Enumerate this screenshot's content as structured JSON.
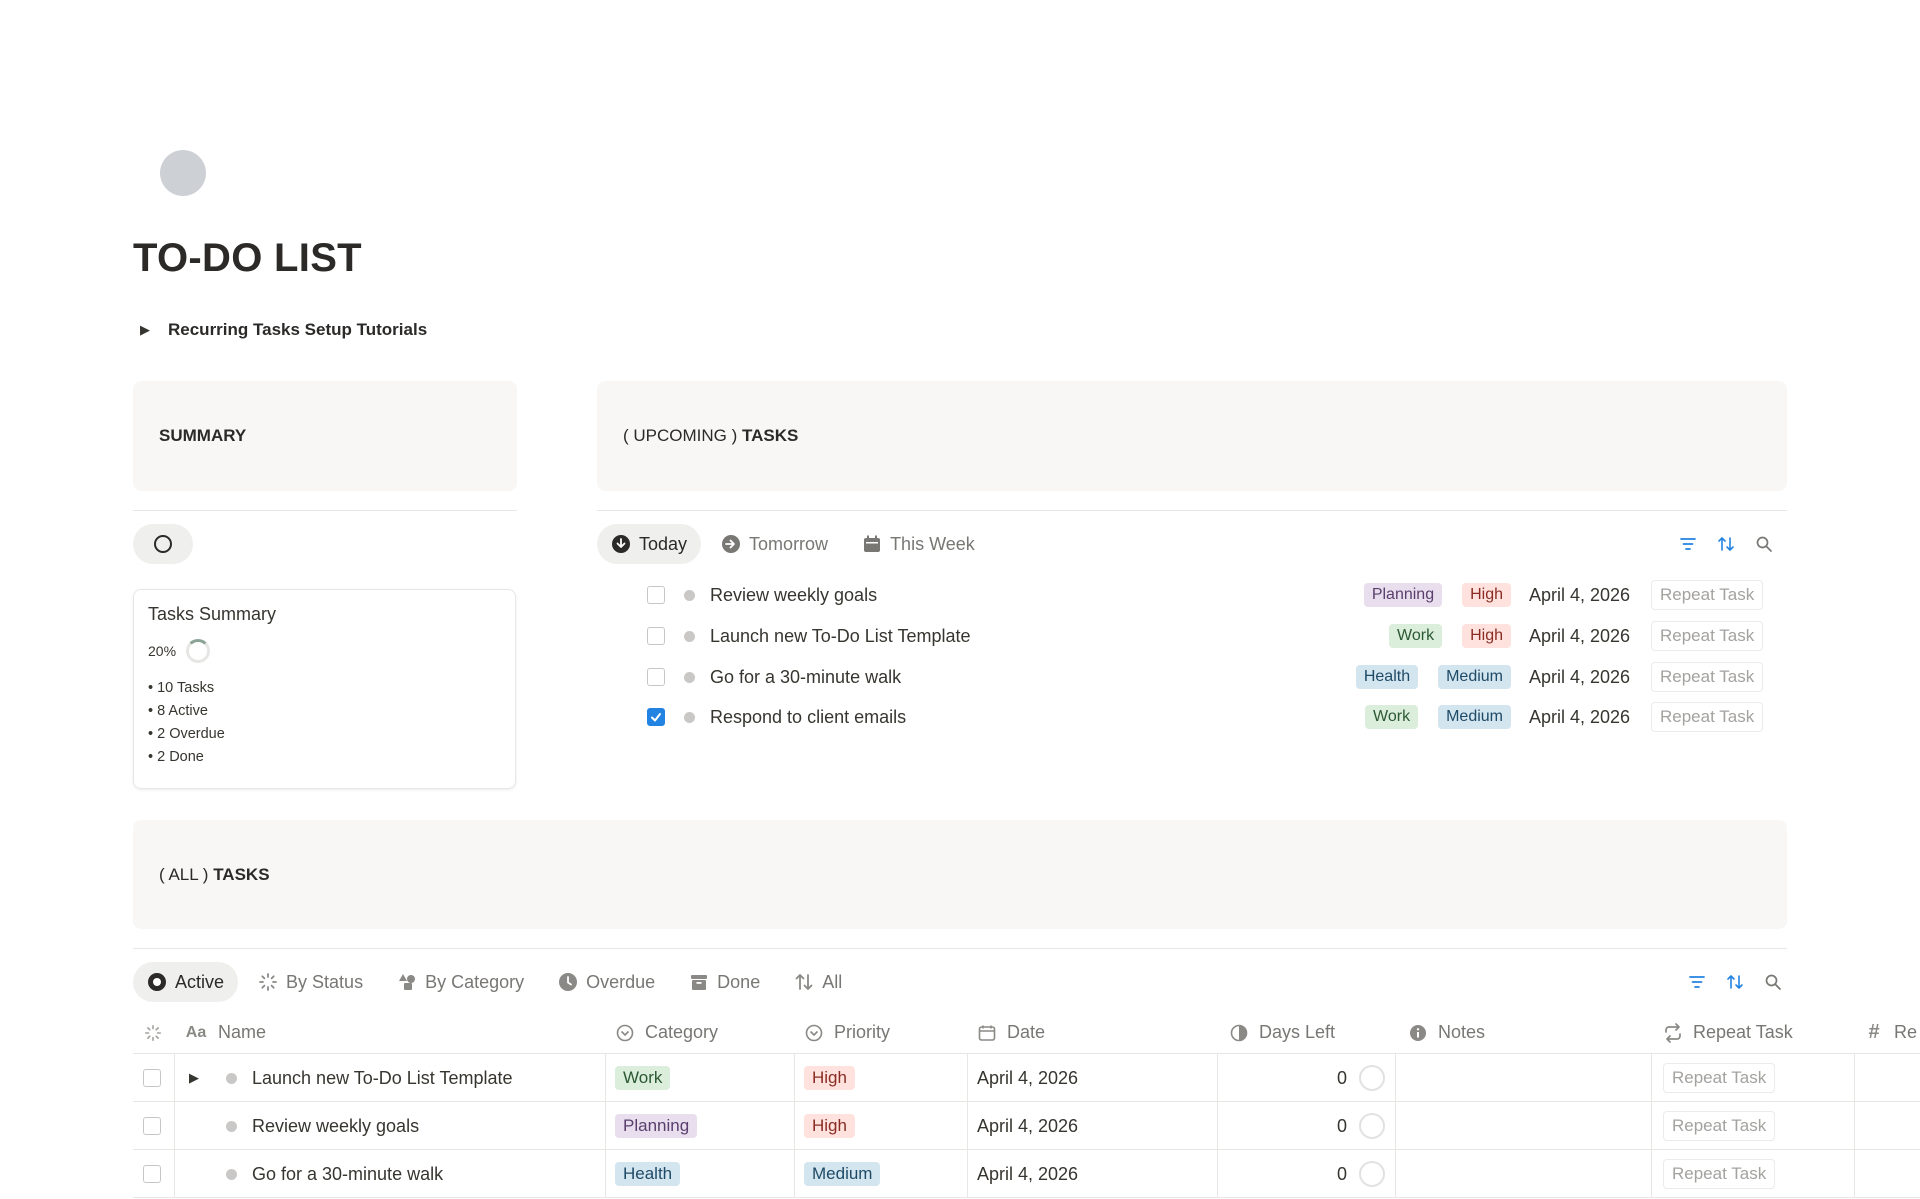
{
  "page": {
    "title": "TO-DO LIST",
    "toggle_label": "Recurring Tasks Setup Tutorials"
  },
  "summary": {
    "heading": "SUMMARY",
    "card_title": "Tasks Summary",
    "percent": "20%",
    "lines": [
      "• 10 Tasks",
      "• 8 Active",
      "• 2 Overdue",
      "• 2 Done"
    ]
  },
  "upcoming": {
    "heading_prefix": "( UPCOMING )",
    "heading_bold": "TASKS",
    "tabs": [
      {
        "label": "Today",
        "icon": "arrow-down-circle-icon"
      },
      {
        "label": "Tomorrow",
        "icon": "arrow-right-circle-icon"
      },
      {
        "label": "This Week",
        "icon": "calendar-icon"
      }
    ],
    "rows": [
      {
        "name": "Review weekly goals",
        "category": "Planning",
        "priority": "High",
        "date": "April 4, 2026",
        "repeat": "Repeat Task",
        "checked": false
      },
      {
        "name": "Launch new To-Do List Template",
        "category": "Work",
        "priority": "High",
        "date": "April 4, 2026",
        "repeat": "Repeat Task",
        "checked": false
      },
      {
        "name": "Go for a 30-minute walk",
        "category": "Health",
        "priority": "Medium",
        "date": "April 4, 2026",
        "repeat": "Repeat Task",
        "checked": false
      },
      {
        "name": "Respond to client emails",
        "category": "Work",
        "priority": "Medium",
        "date": "April 4, 2026",
        "repeat": "Repeat Task",
        "checked": true
      }
    ]
  },
  "all_tasks": {
    "heading_prefix": "( ALL )",
    "heading_bold": "TASKS",
    "tabs": [
      {
        "label": "Active",
        "icon": "filled-circle-icon"
      },
      {
        "label": "By Status",
        "icon": "loading-icon"
      },
      {
        "label": "By Category",
        "icon": "shapes-icon"
      },
      {
        "label": "Overdue",
        "icon": "clock-icon"
      },
      {
        "label": "Done",
        "icon": "archive-icon"
      },
      {
        "label": "All",
        "icon": "sort-arrows-icon"
      }
    ],
    "columns": {
      "name": "Name",
      "category": "Category",
      "priority": "Priority",
      "date": "Date",
      "days_left": "Days Left",
      "notes": "Notes",
      "repeat": "Repeat Task",
      "extra": "Re"
    },
    "rows": [
      {
        "name": "Launch new To-Do List Template",
        "category": "Work",
        "priority": "High",
        "date": "April 4, 2026",
        "days_left": "0",
        "repeat": "Repeat Task",
        "expandable": true
      },
      {
        "name": "Review weekly goals",
        "category": "Planning",
        "priority": "High",
        "date": "April 4, 2026",
        "days_left": "0",
        "repeat": "Repeat Task",
        "expandable": false
      },
      {
        "name": "Go for a 30-minute walk",
        "category": "Health",
        "priority": "Medium",
        "date": "April 4, 2026",
        "days_left": "0",
        "repeat": "Repeat Task",
        "expandable": false
      }
    ]
  },
  "colors": {
    "accent": "#2383e2",
    "callout_bg": "#f8f7f5",
    "text": "#37352f"
  }
}
